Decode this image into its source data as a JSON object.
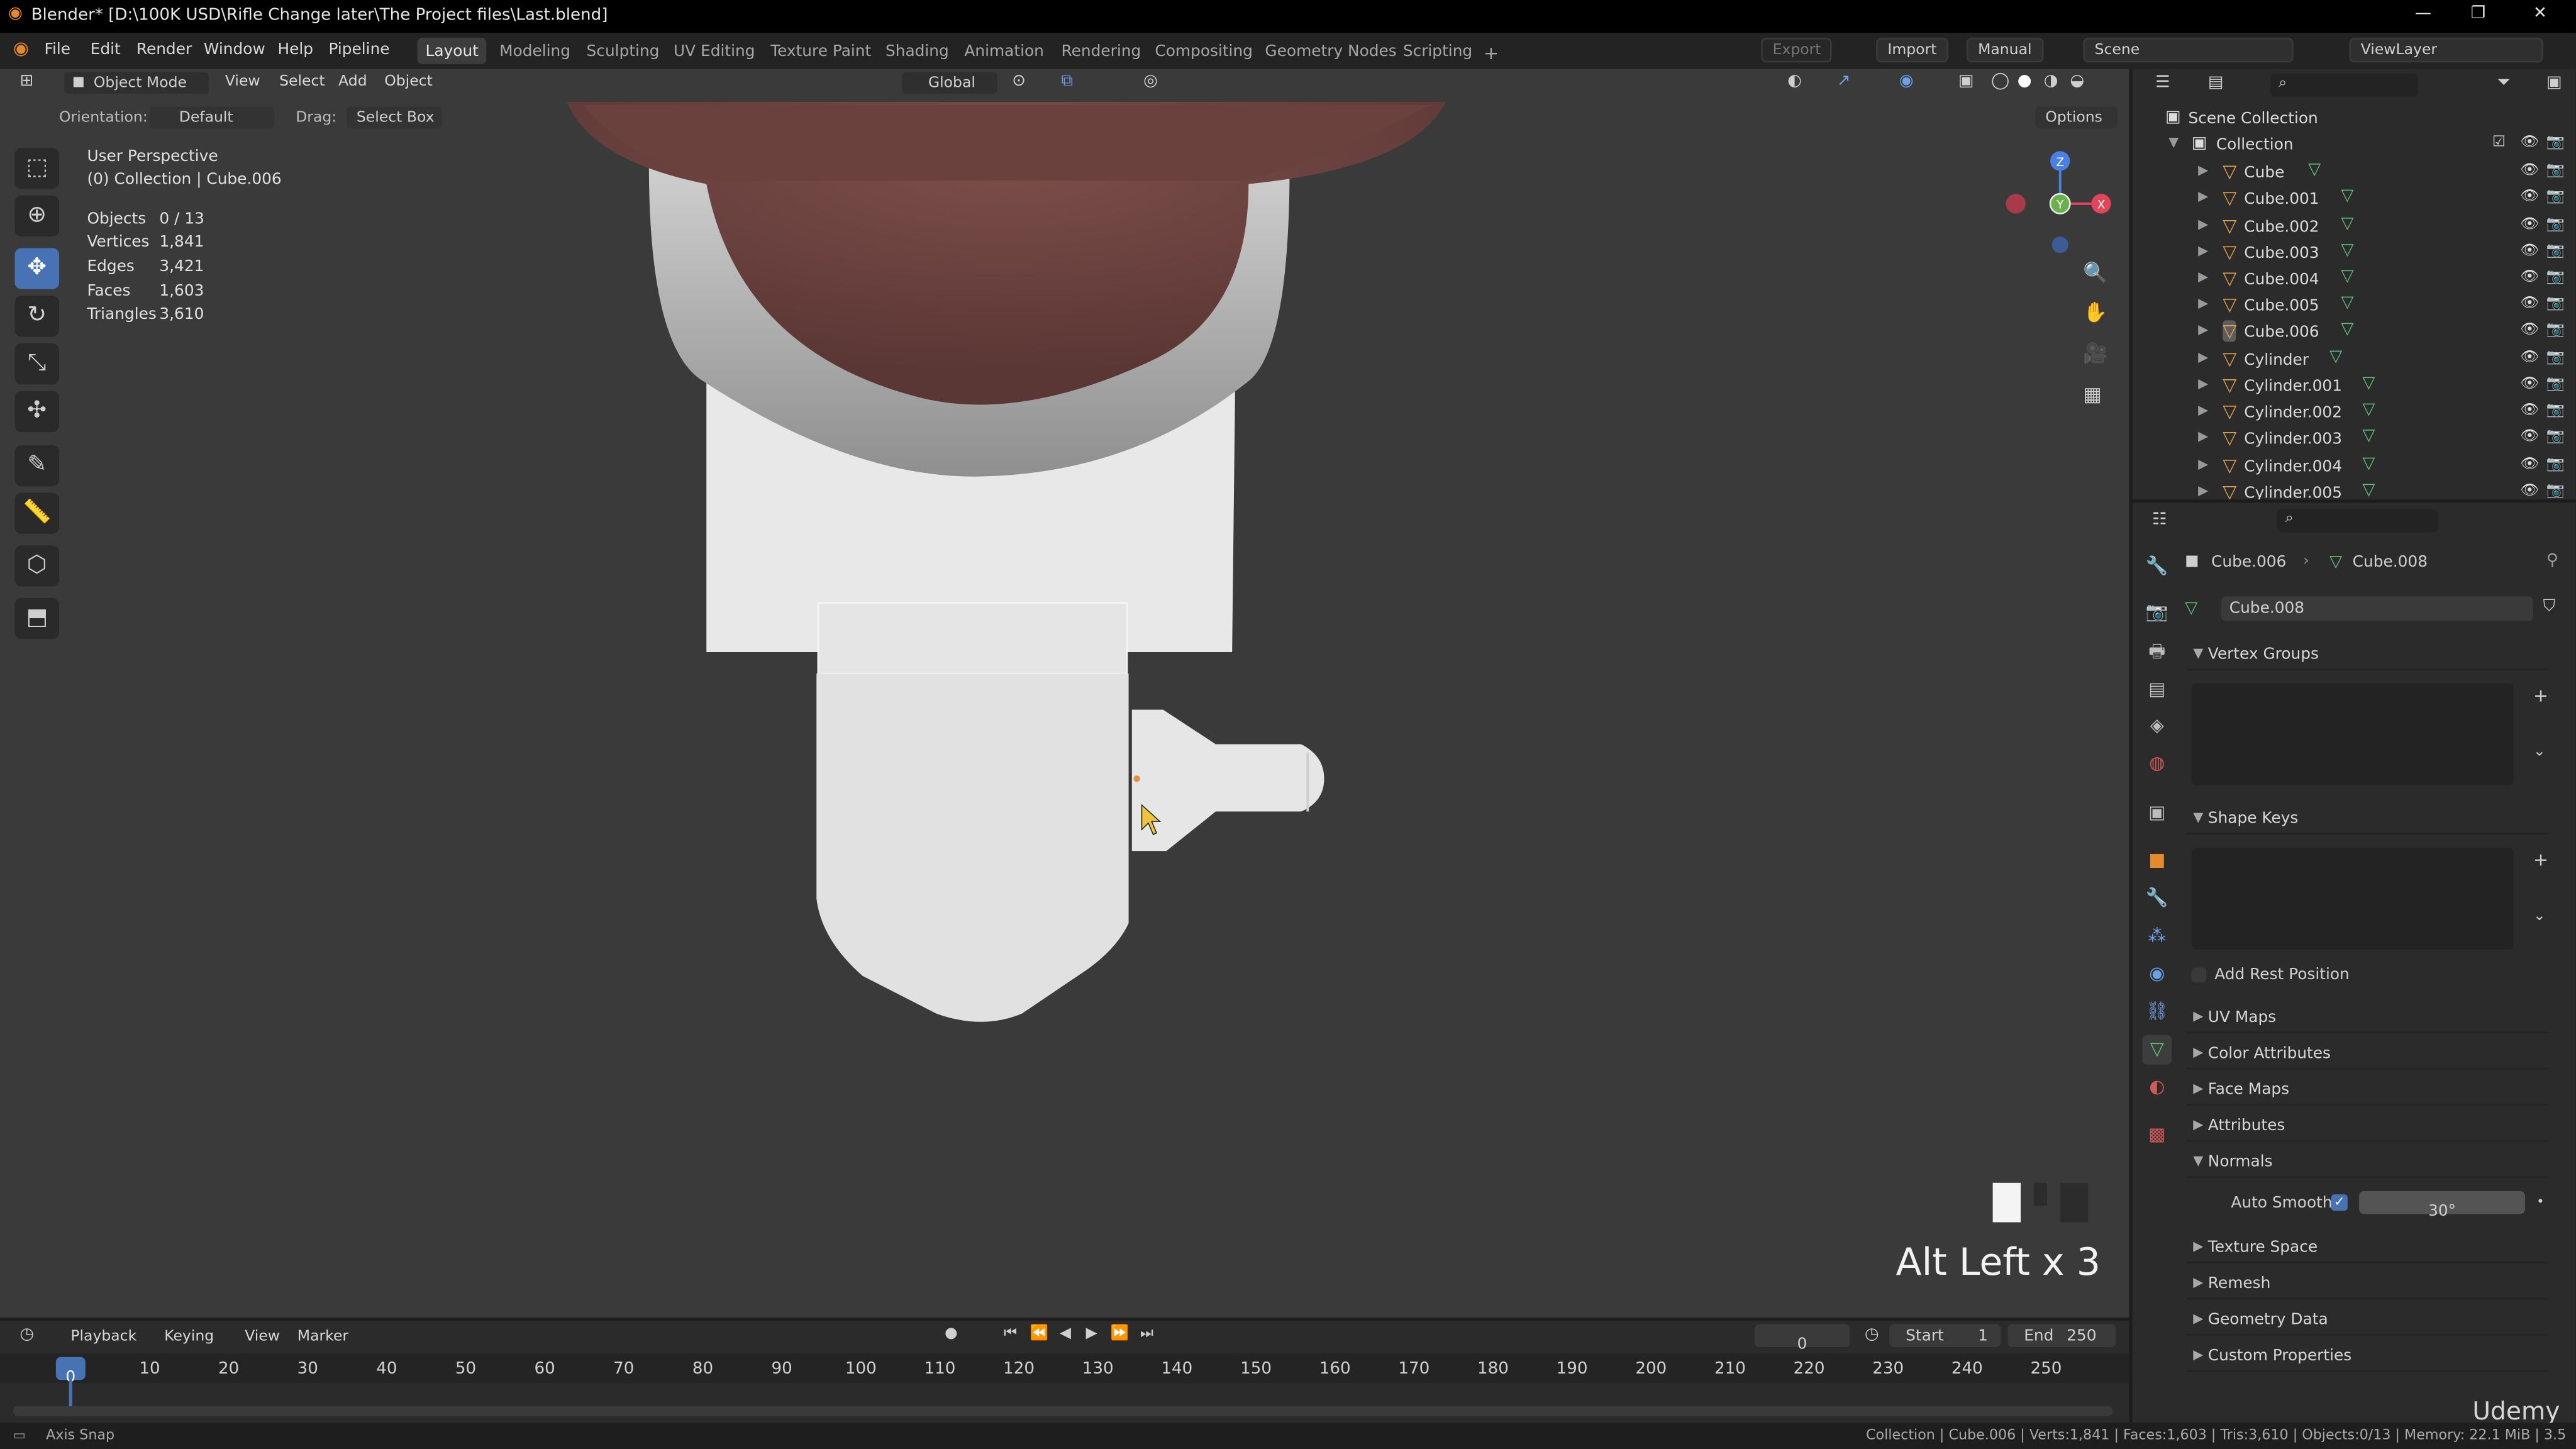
{
  "window": {
    "title": "Blender* [D:\\100K USD\\Rifle Change later\\The Project files\\Last.blend]",
    "controls": [
      "—",
      "❐",
      "✕"
    ]
  },
  "menubar": {
    "menus": [
      "File",
      "Edit",
      "Render",
      "Window",
      "Help",
      "Pipeline"
    ],
    "workspaces": [
      "Layout",
      "Modeling",
      "Sculpting",
      "UV Editing",
      "Texture Paint",
      "Shading",
      "Animation",
      "Rendering",
      "Compositing",
      "Geometry Nodes",
      "Scripting"
    ],
    "active_workspace": "Layout",
    "add_tab": "+",
    "export_label": "Export",
    "import_label": "Import",
    "manual_label": "Manual",
    "scene": "Scene",
    "view_layer": "ViewLayer"
  },
  "viewport_header": {
    "mode": "Object Mode",
    "menus": [
      "View",
      "Select",
      "Add",
      "Object"
    ],
    "transform": "Global",
    "orientation_label": "Orientation:",
    "orientation_value": "Default",
    "drag_label": "Drag:",
    "drag_value": "Select Box",
    "options": "Options"
  },
  "viewport": {
    "view_name": "User Perspective",
    "collection_path": "(0) Collection | Cube.006",
    "stats": [
      {
        "label": "Objects",
        "value": "0 / 13"
      },
      {
        "label": "Vertices",
        "value": "1,841"
      },
      {
        "label": "Edges",
        "value": "3,421"
      },
      {
        "label": "Faces",
        "value": "1,603"
      },
      {
        "label": "Triangles",
        "value": "3,610"
      }
    ],
    "key_overlay": "Alt Left x 3",
    "gizmo_axes": {
      "z": "Z",
      "y": "Y",
      "x": "X"
    }
  },
  "outliner": {
    "root": "Scene Collection",
    "collection": "Collection",
    "items": [
      "Cube",
      "Cube.001",
      "Cube.002",
      "Cube.003",
      "Cube.004",
      "Cube.005",
      "Cube.006",
      "Cylinder",
      "Cylinder.001",
      "Cylinder.002",
      "Cylinder.003",
      "Cylinder.004",
      "Cylinder.005"
    ],
    "active_item": "Cube.006"
  },
  "properties": {
    "breadcrumb_object": "Cube.006",
    "breadcrumb_mesh": "Cube.008",
    "mesh_name": "Cube.008",
    "panels": {
      "vertex_groups": "Vertex Groups",
      "shape_keys": "Shape Keys",
      "add_rest_position": "Add Rest Position",
      "uv_maps": "UV Maps",
      "color_attributes": "Color Attributes",
      "face_maps": "Face Maps",
      "attributes": "Attributes",
      "normals": "Normals",
      "auto_smooth_label": "Auto Smooth",
      "auto_smooth_angle": "30°",
      "texture_space": "Texture Space",
      "remesh": "Remesh",
      "geometry_data": "Geometry Data",
      "custom_properties": "Custom Properties"
    }
  },
  "timeline": {
    "menus": [
      "Playback",
      "Keying",
      "View",
      "Marker"
    ],
    "current_frame": "0",
    "start_label": "Start",
    "start_value": "1",
    "end_label": "End",
    "end_value": "250",
    "ticks": [
      "0",
      "10",
      "20",
      "30",
      "40",
      "50",
      "60",
      "70",
      "80",
      "90",
      "100",
      "110",
      "120",
      "130",
      "140",
      "150",
      "160",
      "170",
      "180",
      "190",
      "200",
      "210",
      "220",
      "230",
      "240",
      "250"
    ],
    "playhead": "0"
  },
  "statusbar": {
    "left": "Axis Snap",
    "right": "Collection | Cube.006 | Verts:1,841 | Faces:1,603 | Tris:3,610 | Objects:0/13 | Memory: 22.1 MiB | 3.5"
  },
  "watermark": "Udemy",
  "colors": {
    "accent": "#4772b3",
    "object_icon": "#e2a04c",
    "mesh_icon": "#5fc37a",
    "viewport_bg": "#3a3a3a"
  }
}
